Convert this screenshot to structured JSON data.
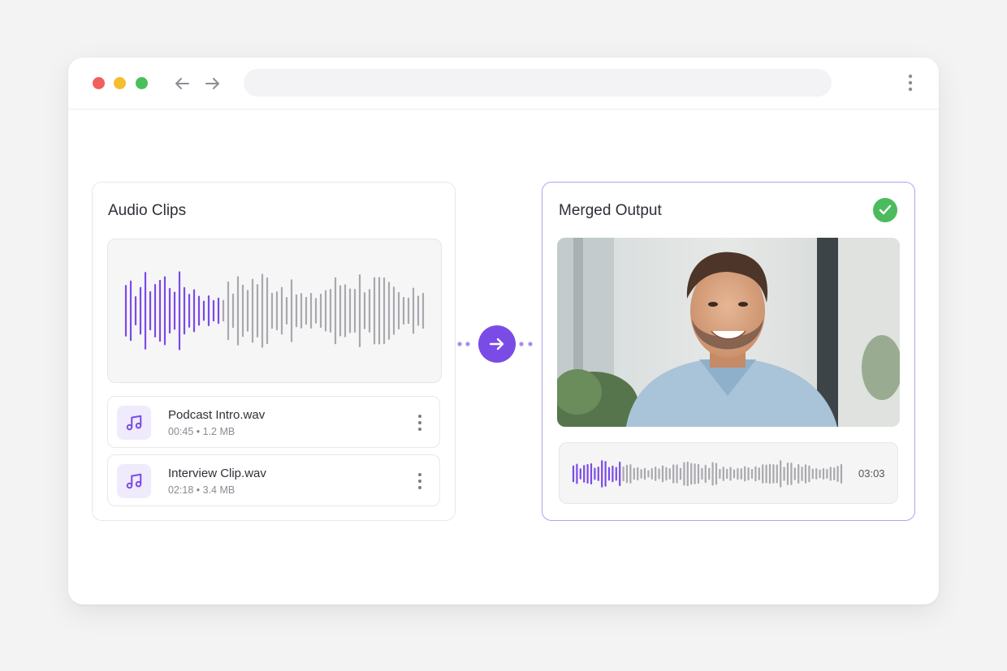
{
  "browser": {
    "address": "",
    "icons": {
      "back": "arrow-left-icon",
      "forward": "arrow-right-icon",
      "menu": "more-vertical-icon"
    }
  },
  "audio_panel": {
    "title": "Audio Clips",
    "clips": [
      {
        "name": "Podcast Intro.wav",
        "duration": "00:45",
        "size": "1.2 MB",
        "icon": "music-note-icon"
      },
      {
        "name": "Interview Clip.wav",
        "duration": "02:18",
        "size": "3.4 MB",
        "icon": "music-note-icon"
      }
    ]
  },
  "merge_button": {
    "icon": "arrow-right-icon"
  },
  "output_panel": {
    "title": "Merged Output",
    "status_icon": "check-icon",
    "media": "smiling-man-photo",
    "duration": "03:03"
  },
  "colors": {
    "accent": "#7b4be6",
    "success": "#4cbb5e",
    "wave_gray": "#a8a8ae"
  }
}
